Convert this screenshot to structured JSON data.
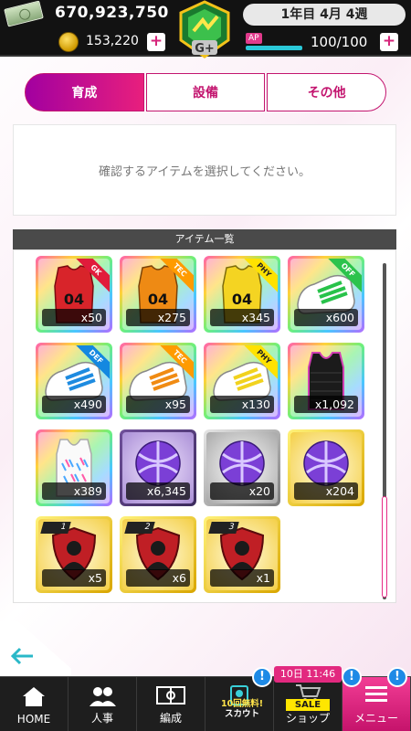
{
  "topbar": {
    "money": "670,923,750",
    "coins": "153,220",
    "plus_label": "+",
    "logo_text": "G+",
    "date": "1年目 4月 4週",
    "ap_label": "AP",
    "ap_value": "100/100"
  },
  "tabs": [
    {
      "label": "育成",
      "active": true
    },
    {
      "label": "設備",
      "active": false
    },
    {
      "label": "その他",
      "active": false
    }
  ],
  "info": {
    "message": "確認するアイテムを選択してください。"
  },
  "list": {
    "header": "アイテム一覧",
    "items": [
      {
        "name": "red-jersey",
        "count": "x50",
        "badge": "GK"
      },
      {
        "name": "orange-jersey",
        "count": "x275",
        "badge": "TEC"
      },
      {
        "name": "yellow-jersey",
        "count": "x345",
        "badge": "PHY"
      },
      {
        "name": "green-cleats",
        "count": "x600",
        "badge": "OFF"
      },
      {
        "name": "blue-cleats",
        "count": "x490",
        "badge": "DEF"
      },
      {
        "name": "orange-cleats",
        "count": "x95",
        "badge": "TEC"
      },
      {
        "name": "yellow-cleats",
        "count": "x130",
        "badge": "PHY"
      },
      {
        "name": "black-vest",
        "count": "x1,092",
        "badge": ""
      },
      {
        "name": "rainbow-vest",
        "count": "x389",
        "badge": ""
      },
      {
        "name": "purple-ball",
        "count": "x6,345",
        "badge": ""
      },
      {
        "name": "silver-ball",
        "count": "x20",
        "badge": ""
      },
      {
        "name": "gold-ball",
        "count": "x204",
        "badge": ""
      },
      {
        "name": "shield-1",
        "count": "x5",
        "badge": "1"
      },
      {
        "name": "shield-2",
        "count": "x6",
        "badge": "2"
      },
      {
        "name": "shield-3",
        "count": "x1",
        "badge": "3"
      }
    ]
  },
  "nav": {
    "home": "HOME",
    "personnel": "人事",
    "formation": "編成",
    "scout_top": "10回無料!",
    "scout_bottom": "スカウト",
    "shop": "ショップ",
    "shop_sale": "SALE",
    "shop_timer": "10日 11:46",
    "menu": "メニュー",
    "notif": "!"
  },
  "colors": {
    "accent": "#e62b86",
    "dark": "#121212",
    "badge_blue": "#1e8ae6"
  }
}
